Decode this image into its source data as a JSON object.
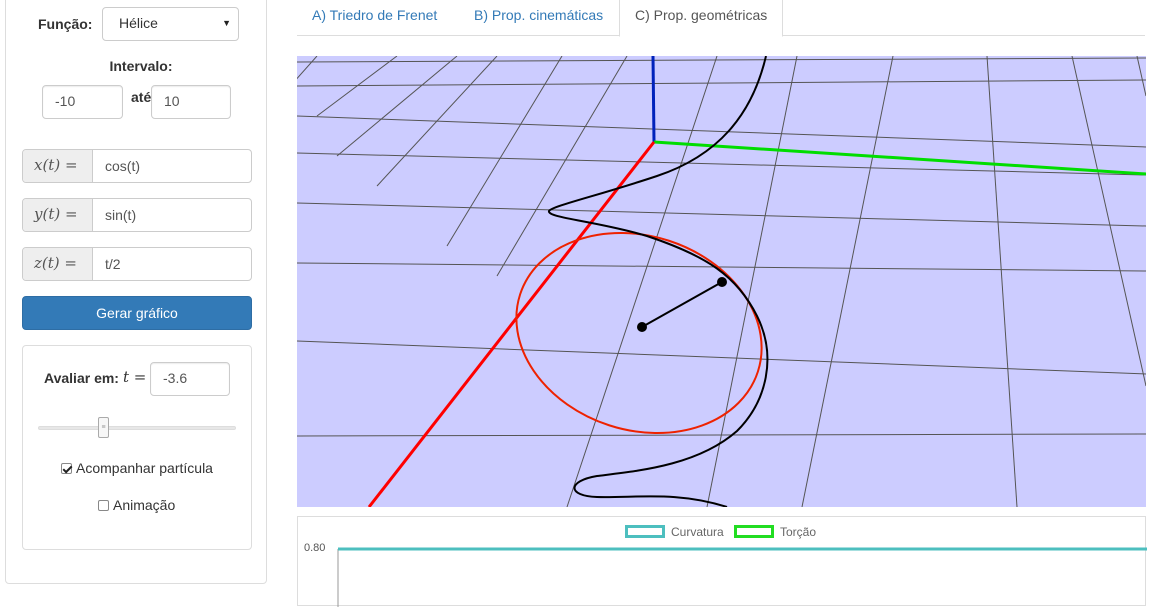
{
  "sidebar": {
    "funcao_label": "Função:",
    "funcao_value": "Hélice",
    "caret": "▼",
    "intervalo_label": "Intervalo:",
    "intervalo_from": "-10",
    "ate_label": "até",
    "intervalo_to": "10",
    "x_label": "x(t) =",
    "x_value": "cos(t)",
    "y_label": "y(t) =",
    "y_value": "sin(t)",
    "z_label": "z(t) =",
    "z_value": "t/2",
    "gerar_button": "Gerar gráfico",
    "avaliar_label": "Avaliar em:",
    "avaliar_var": "t =",
    "avaliar_value": "-3.6",
    "slider_value": -3.6,
    "slider_handle_glyph": "≡",
    "acompanhar_label": "Acompanhar partícula",
    "acompanhar_checked": true,
    "animacao_label": "Animação",
    "animacao_checked": false
  },
  "tabs": [
    {
      "label": "A) Triedro de Frenet",
      "active": false
    },
    {
      "label": "B) Prop. cinemáticas",
      "active": false
    },
    {
      "label": "C) Prop. geométricas",
      "active": true
    }
  ],
  "view3d": {
    "background": "#ccccff",
    "grid_color": "#555555",
    "curve_color": "#000000",
    "osculating_circle_color": "#ee2200",
    "axis_x_color": "#ff0000",
    "axis_y_color": "#00dd00",
    "axis_z_color": "#0022bb"
  },
  "chart": {
    "legend": [
      {
        "label": "Curvatura",
        "color": "#4dbfbf"
      },
      {
        "label": "Torção",
        "color": "#22dd22"
      }
    ],
    "ytick_top": "0.80"
  }
}
